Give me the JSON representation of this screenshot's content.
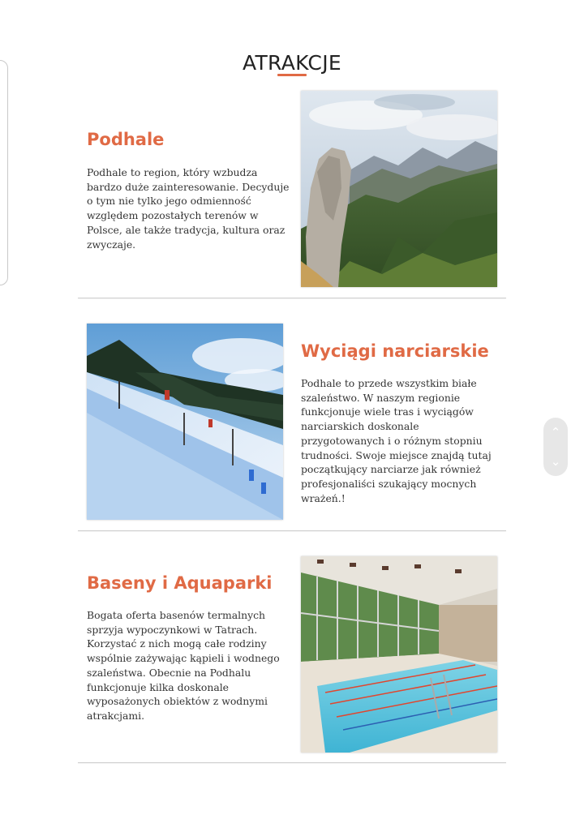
{
  "page": {
    "heading": "ATRAKCJE",
    "accent_color": "#e06a45"
  },
  "sections": [
    {
      "title": "Podhale",
      "text": "Podhale to region, który wzbudza bardzo duże zainteresowanie. Decyduje o tym nie tylko jego odmienność względem pozostałych terenów w Polsce, ale także tradycja, kultura oraz zwyczaje.",
      "image": "mountain-landscape-photo"
    },
    {
      "title": "Wyciągi narciarskie",
      "text": "Podhale to przede wszystkim białe szaleństwo. W naszym regionie funkcjonuje wiele tras i wyciągów narciarskich doskonale przygotowanych i o różnym stopniu trudności. Swoje miejsce znajdą tutaj początkujący narciarze jak również profesjonaliści szukający mocnych wrażeń.!",
      "image": "ski-slope-photo"
    },
    {
      "title": "Baseny i Aquaparki",
      "text": "Bogata oferta basenów termalnych sprzyja wypoczynkowi w Tatrach. Korzystać z nich mogą całe rodziny wspólnie zażywając kąpieli i wodnego szaleństwa. Obecnie na Podhalu funkcjonuje kilka doskonale wyposażonych obiektów z wodnymi atrakcjami.",
      "image": "indoor-pool-photo"
    }
  ],
  "scroll_controls": {
    "up_icon": "chevron-up-icon",
    "down_icon": "chevron-down-icon"
  }
}
